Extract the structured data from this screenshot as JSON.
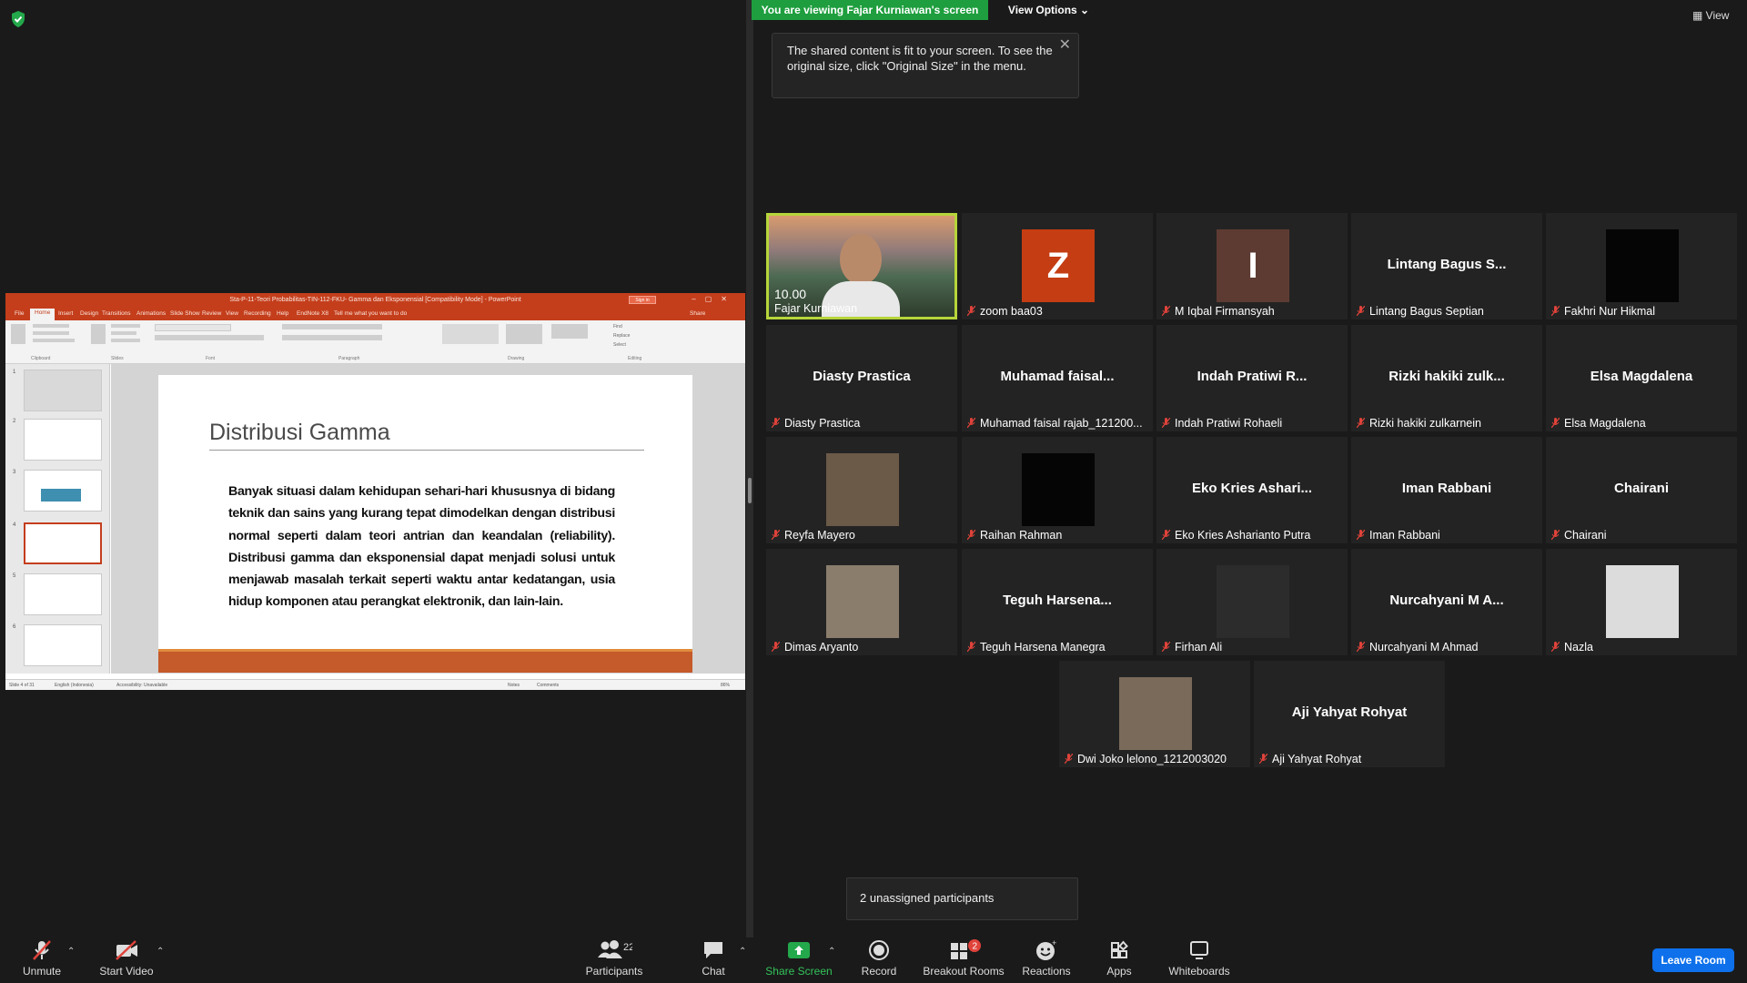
{
  "banner": {
    "viewing_text": "You are viewing Fajar Kurniawan's screen",
    "view_options": "View Options ⌄",
    "view": "View"
  },
  "tooltip": {
    "text": "The shared content is fit to your screen. To see the original size, click \"Original Size\" in the menu."
  },
  "ppt": {
    "window_title": "Sta-P-11-Teori Probabilitas-TIN-112-FKU- Gamma dan Eksponensial [Compatibility Mode] - PowerPoint",
    "sign_in": "Sign in",
    "tabs": [
      "File",
      "Home",
      "Insert",
      "Design",
      "Transitions",
      "Animations",
      "Slide Show",
      "Review",
      "View",
      "Recording",
      "Help",
      "EndNote X8",
      "Tell me what you want to do"
    ],
    "share": "Share",
    "ribbon_groups": [
      "Clipboard",
      "Slides",
      "Font",
      "Paragraph",
      "Drawing",
      "Editing"
    ],
    "editing": [
      "Find",
      "Replace",
      "Select"
    ],
    "slide_title": "Distribusi Gamma",
    "slide_body": "Banyak situasi dalam kehidupan sehari-hari khususnya di bidang teknik dan sains yang kurang tepat dimodelkan dengan distribusi normal seperti dalam teori antrian dan keandalan (reliability). Distribusi gamma dan eksponensial dapat menjadi solusi untuk menjawab masalah terkait seperti waktu antar kedatangan, usia hidup komponen atau perangkat elektronik, dan lain-lain.",
    "status_slide": "Slide 4 of 31",
    "status_lang": "English (Indonesia)",
    "status_access": "Accessibility: Unavailable",
    "status_notes": "Notes",
    "status_comments": "Comments",
    "status_zoom": "86%"
  },
  "participants_tiles": [
    {
      "label": "Fajar Kurniawan",
      "type": "video",
      "overlay": "10.00"
    },
    {
      "label": "zoom baa03",
      "type": "letter",
      "letter": "Z",
      "color": "#c53d13"
    },
    {
      "label": "M Iqbal Firmansyah",
      "type": "letter",
      "letter": "I",
      "color": "#5d3b32"
    },
    {
      "label": "Lintang Bagus Septian",
      "type": "name",
      "center": "Lintang Bagus S..."
    },
    {
      "label": "Fakhri Nur Hikmal",
      "type": "black"
    },
    {
      "label": "Diasty Prastica",
      "type": "name",
      "center": "Diasty Prastica"
    },
    {
      "label": "Muhamad faisal rajab_121200...",
      "type": "name",
      "center": "Muhamad faisal..."
    },
    {
      "label": "Indah Pratiwi Rohaeli",
      "type": "name",
      "center": "Indah Pratiwi R..."
    },
    {
      "label": "Rizki hakiki zulkarnein",
      "type": "name",
      "center": "Rizki hakiki zulk..."
    },
    {
      "label": "Elsa Magdalena",
      "type": "name",
      "center": "Elsa Magdalena"
    },
    {
      "label": "Reyfa Mayero",
      "type": "photo",
      "bg": "#6b5a48"
    },
    {
      "label": "Raihan Rahman",
      "type": "black"
    },
    {
      "label": "Eko Kries Asharianto Putra",
      "type": "name",
      "center": "Eko Kries Ashari..."
    },
    {
      "label": "Iman Rabbani",
      "type": "name",
      "center": "Iman Rabbani"
    },
    {
      "label": "Chairani",
      "type": "name",
      "center": "Chairani"
    },
    {
      "label": "Dimas Aryanto",
      "type": "photo",
      "bg": "#8a7d6c"
    },
    {
      "label": "Teguh Harsena Manegra",
      "type": "name",
      "center": "Teguh Harsena..."
    },
    {
      "label": "Firhan Ali",
      "type": "photo",
      "bg": "#2c2c2c"
    },
    {
      "label": "Nurcahyani M Ahmad",
      "type": "name",
      "center": "Nurcahyani M A..."
    },
    {
      "label": "Nazla",
      "type": "photo",
      "bg": "#dcdcdc"
    },
    {
      "label": "Dwi Joko lelono_1212003020",
      "type": "photo",
      "bg": "#7a6a5a"
    },
    {
      "label": "Aji Yahyat Rohyat",
      "type": "name",
      "center": "Aji Yahyat Rohyat"
    }
  ],
  "unassigned": "2 unassigned participants",
  "toolbar": {
    "unmute": "Unmute",
    "start_video": "Start Video",
    "participants": "Participants",
    "participants_count": "22",
    "chat": "Chat",
    "share_screen": "Share Screen",
    "record": "Record",
    "breakout_rooms": "Breakout Rooms",
    "breakout_badge": "2",
    "reactions": "Reactions",
    "apps": "Apps",
    "whiteboards": "Whiteboards",
    "leave": "Leave Room"
  },
  "colors": {
    "share_green": "#1e9e3e",
    "leave_blue": "#0e71eb",
    "ppt_orange": "#c43e1c",
    "active_border": "#b6d53a",
    "mute_red": "#e0433a"
  }
}
